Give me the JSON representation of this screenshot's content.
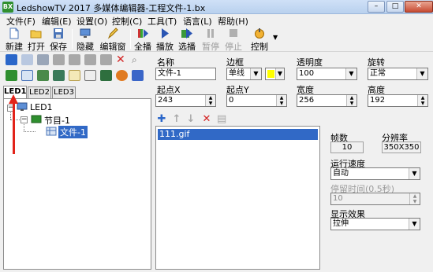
{
  "window": {
    "title": "LedshowTV 2017 多媒体编辑器-工程文件-1.bx",
    "app_icon": "BX",
    "controls": [
      "minimize",
      "maximize",
      "close"
    ]
  },
  "menu": [
    {
      "label": "文件(F)"
    },
    {
      "label": "编辑(E)"
    },
    {
      "label": "设置(O)"
    },
    {
      "label": "控制(C)"
    },
    {
      "label": "工具(T)"
    },
    {
      "label": "语言(L)"
    },
    {
      "label": "帮助(H)"
    }
  ],
  "toolbar": [
    {
      "label": "新建",
      "icon": "new-file-icon",
      "disabled": false
    },
    {
      "label": "打开",
      "icon": "open-folder-icon",
      "disabled": false
    },
    {
      "label": "保存",
      "icon": "save-icon",
      "disabled": false
    },
    {
      "label": "隐藏",
      "icon": "hide-screen-icon",
      "disabled": false
    },
    {
      "label": "编辑窗",
      "icon": "edit-window-icon",
      "disabled": false
    },
    {
      "label": "全播",
      "icon": "play-all-icon",
      "disabled": false
    },
    {
      "label": "播放",
      "icon": "play-icon",
      "disabled": false
    },
    {
      "label": "选播",
      "icon": "select-play-icon",
      "disabled": false
    },
    {
      "label": "暂停",
      "icon": "pause-icon",
      "disabled": true
    },
    {
      "label": "停止",
      "icon": "stop-icon",
      "disabled": true
    },
    {
      "label": "控制",
      "icon": "control-icon",
      "disabled": false
    }
  ],
  "left_tabs": [
    "LED1",
    "LED2",
    "LED3"
  ],
  "tree": {
    "root": "LED1",
    "program": "节目-1",
    "file": "文件-1"
  },
  "properties": {
    "name_label": "名称",
    "name_value": "文件-1",
    "border_label": "边框",
    "border_value": "单线",
    "border_color": "#ffff00",
    "transparency_label": "透明度",
    "transparency_value": "100",
    "rotation_label": "旋转",
    "rotation_value": "正常",
    "x_label": "起点X",
    "x_value": "243",
    "y_label": "起点Y",
    "y_value": "0",
    "width_label": "宽度",
    "width_value": "256",
    "height_label": "高度",
    "height_value": "192"
  },
  "file_list": [
    "111.gif"
  ],
  "media": {
    "frames_label": "帧数",
    "frames_value": "10",
    "resolution_label": "分辨率",
    "resolution_value": "350X350",
    "speed_label": "运行速度",
    "speed_value": "自动",
    "stay_label": "停留时间(0.5秒)",
    "stay_value": "10",
    "effect_label": "显示效果",
    "effect_value": "拉伸"
  },
  "colors": {
    "selection": "#3169c6",
    "arrow": "#e2231a",
    "titlebar": "#c4d8f2"
  }
}
